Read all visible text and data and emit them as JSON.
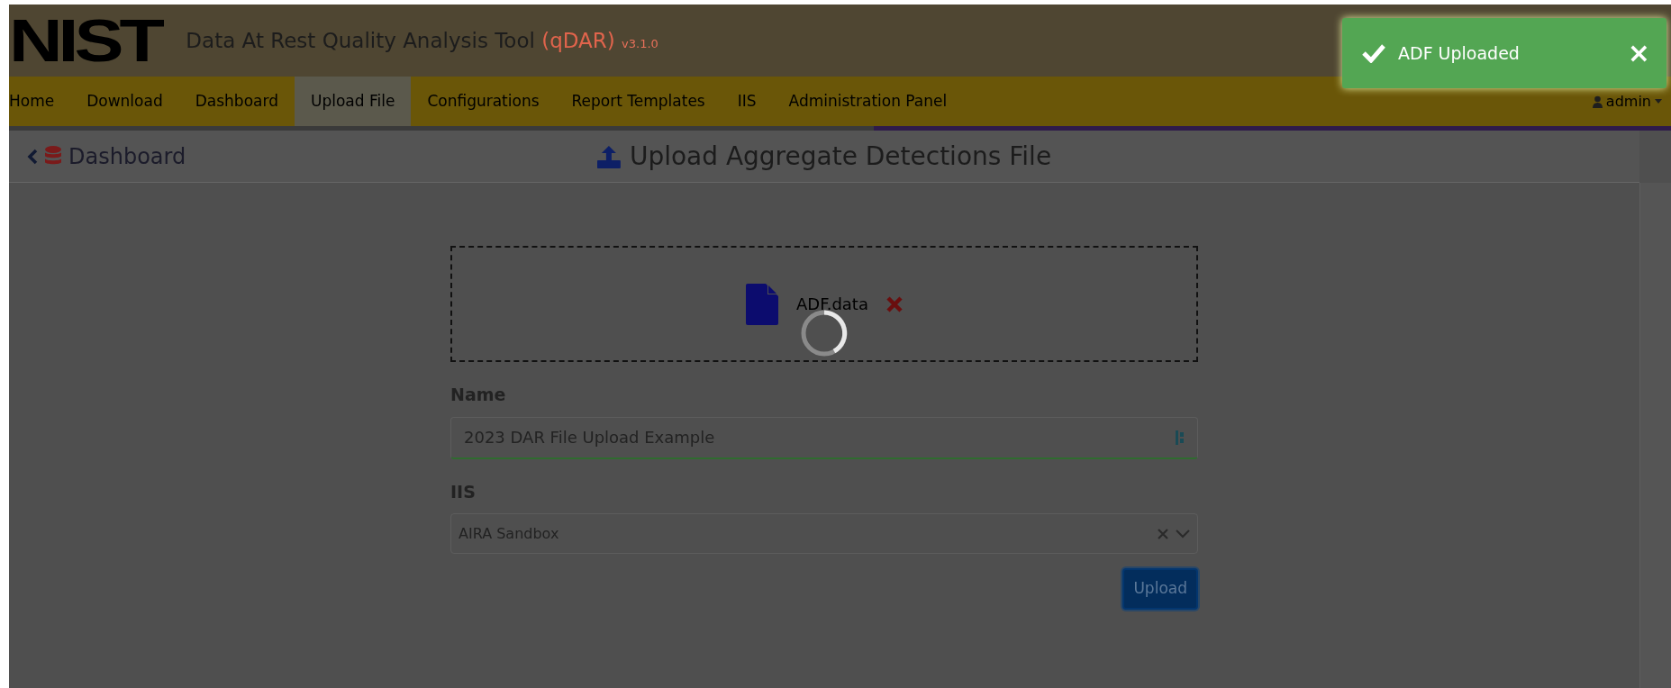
{
  "header": {
    "logo": "NIST",
    "title": "Data At Rest Quality Analysis Tool",
    "app_code": "(qDAR)",
    "version": "v3.1.0"
  },
  "nav": {
    "items": [
      {
        "label": "Home",
        "selected": false
      },
      {
        "label": "Download",
        "selected": false
      },
      {
        "label": "Dashboard",
        "selected": false
      },
      {
        "label": "Upload File",
        "selected": true
      },
      {
        "label": "Configurations",
        "selected": false
      },
      {
        "label": "Report Templates",
        "selected": false
      },
      {
        "label": "IIS",
        "selected": false
      },
      {
        "label": "Administration Panel",
        "selected": false
      }
    ],
    "user": "admin"
  },
  "toast": {
    "message": "ADF Uploaded",
    "close": "×"
  },
  "subheader": {
    "back_link": "Dashboard",
    "title": "Upload Aggregate Detections File"
  },
  "form": {
    "file_name": "ADF.data",
    "loading": true,
    "name_label": "Name",
    "name_value": "2023 DAR File Upload Example",
    "iis_label": "IIS",
    "iis_value": "AIRA Sandbox",
    "submit": "Upload"
  }
}
